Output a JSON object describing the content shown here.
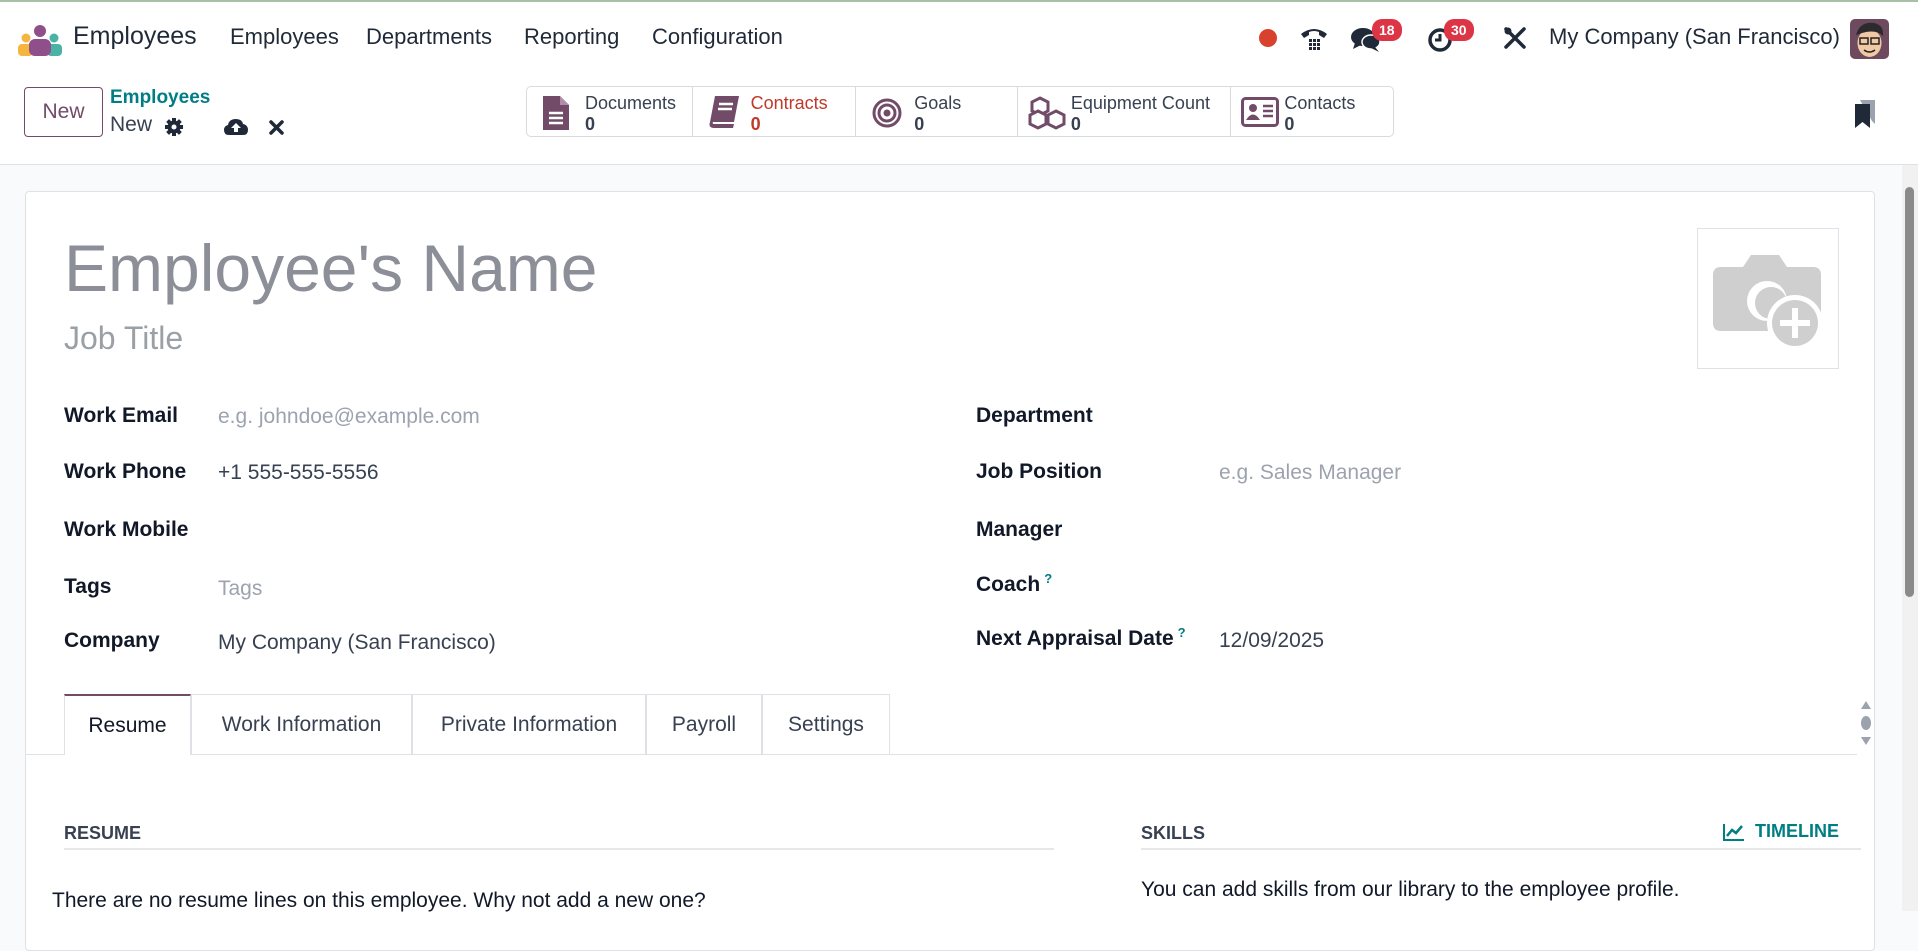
{
  "topbar": {
    "app_name": "Employees",
    "menu": [
      "Employees",
      "Departments",
      "Reporting",
      "Configuration"
    ],
    "messages_badge": "18",
    "activities_badge": "30",
    "company": "My Company (San Francisco)"
  },
  "control_panel": {
    "new_label": "New",
    "breadcrumb_parent": "Employees",
    "breadcrumb_current": "New",
    "stats": [
      {
        "label": "Documents",
        "value": "0"
      },
      {
        "label": "Contracts",
        "value": "0"
      },
      {
        "label": "Goals",
        "value": "0"
      },
      {
        "label": "Equipment Count",
        "value": "0"
      },
      {
        "label": "Contacts",
        "value": "0"
      }
    ]
  },
  "form": {
    "name_placeholder": "Employee's Name",
    "job_title_placeholder": "Job Title",
    "left_fields": [
      {
        "label": "Work Email",
        "placeholder": "e.g. johndoe@example.com"
      },
      {
        "label": "Work Phone",
        "value": "+1 555-555-5556"
      },
      {
        "label": "Work Mobile",
        "value": ""
      },
      {
        "label": "Tags",
        "placeholder": "Tags"
      },
      {
        "label": "Company",
        "value": "My Company (San Francisco)"
      }
    ],
    "right_fields": [
      {
        "label": "Department",
        "value": ""
      },
      {
        "label": "Job Position",
        "placeholder": "e.g. Sales Manager"
      },
      {
        "label": "Manager",
        "value": ""
      },
      {
        "label": "Coach",
        "help": "?"
      },
      {
        "label": "Next Appraisal Date",
        "help": "?",
        "value": "12/09/2025"
      }
    ],
    "tabs": [
      "Resume",
      "Work Information",
      "Private Information",
      "Payroll",
      "Settings"
    ],
    "active_tab": "Resume",
    "resume": {
      "title": "RESUME",
      "empty_text": "There are no resume lines on this employee. Why not add a new one?"
    },
    "skills": {
      "title": "SKILLS",
      "timeline_label": "TIMELINE",
      "empty_text": "You can add skills from our library to the employee profile."
    }
  },
  "colors": {
    "brand": "#714b67",
    "teal": "#017e84",
    "badge": "#dc3545",
    "contracts": "#c0392b"
  }
}
